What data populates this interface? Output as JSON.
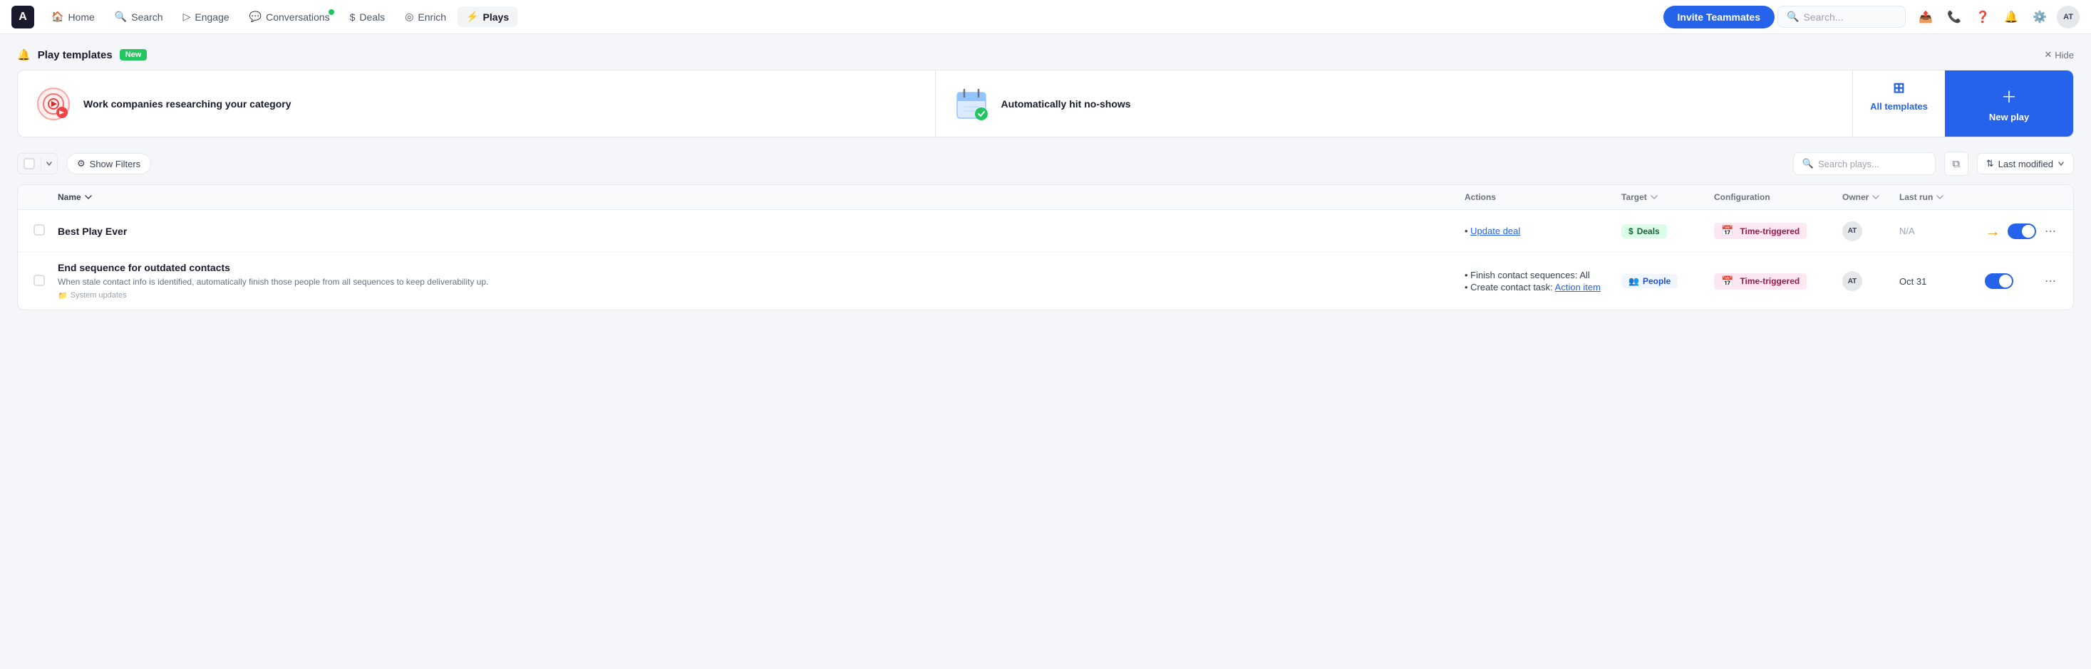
{
  "app": {
    "logo": "A"
  },
  "nav": {
    "items": [
      {
        "id": "home",
        "label": "Home",
        "icon": "🏠",
        "active": false
      },
      {
        "id": "search",
        "label": "Search",
        "icon": "🔍",
        "active": false
      },
      {
        "id": "engage",
        "label": "Engage",
        "icon": "▷",
        "active": false
      },
      {
        "id": "conversations",
        "label": "Conversations",
        "icon": "💬",
        "active": false,
        "dot": true
      },
      {
        "id": "deals",
        "label": "Deals",
        "icon": "$",
        "active": false
      },
      {
        "id": "enrich",
        "label": "Enrich",
        "icon": "◎",
        "active": false
      },
      {
        "id": "plays",
        "label": "Plays",
        "icon": "⚡",
        "active": true
      }
    ],
    "invite_btn": "Invite Teammates",
    "search_placeholder": "Search...",
    "user_initials": "AT"
  },
  "play_templates": {
    "title": "Play templates",
    "badge": "New",
    "hide_label": "Hide",
    "cards": [
      {
        "id": "research",
        "icon": "🎯",
        "text": "Work companies researching your category"
      },
      {
        "id": "noshows",
        "icon": "📅",
        "text": "Automatically hit no-shows"
      }
    ],
    "all_templates_label": "All templates",
    "new_play_label": "New play"
  },
  "toolbar": {
    "show_filters_label": "Show Filters",
    "search_placeholder": "Search plays...",
    "sort_label": "Last modified",
    "copy_icon": "copy"
  },
  "table": {
    "headers": [
      {
        "id": "checkbox",
        "label": ""
      },
      {
        "id": "name",
        "label": "Name",
        "sortable": true
      },
      {
        "id": "actions",
        "label": "Actions"
      },
      {
        "id": "target",
        "label": "Target",
        "sortable": true
      },
      {
        "id": "configuration",
        "label": "Configuration"
      },
      {
        "id": "owner",
        "label": "Owner",
        "sortable": true
      },
      {
        "id": "last_run",
        "label": "Last run",
        "sortable": true
      },
      {
        "id": "toggle",
        "label": ""
      },
      {
        "id": "more",
        "label": ""
      }
    ],
    "rows": [
      {
        "id": "row1",
        "name": "Best Play Ever",
        "description": "",
        "folder": "",
        "actions": [
          {
            "label": "Update deal",
            "link": true
          }
        ],
        "target": "Deals",
        "target_type": "deals",
        "configuration": "Time-triggered",
        "owner": "AT",
        "last_run": "N/A",
        "enabled": true,
        "arrow": true
      },
      {
        "id": "row2",
        "name": "End sequence for outdated contacts",
        "description": "When stale contact info is identified, automatically finish those people from all sequences to keep deliverability up.",
        "folder": "System updates",
        "actions": [
          {
            "label": "Finish contact sequences: All",
            "link": false
          },
          {
            "label": "Create contact task: Action item",
            "link": true,
            "link_part": "Action item"
          }
        ],
        "target": "People",
        "target_type": "people",
        "configuration": "Time-triggered",
        "owner": "AT",
        "last_run": "Oct 31",
        "enabled": true,
        "arrow": false
      }
    ]
  }
}
